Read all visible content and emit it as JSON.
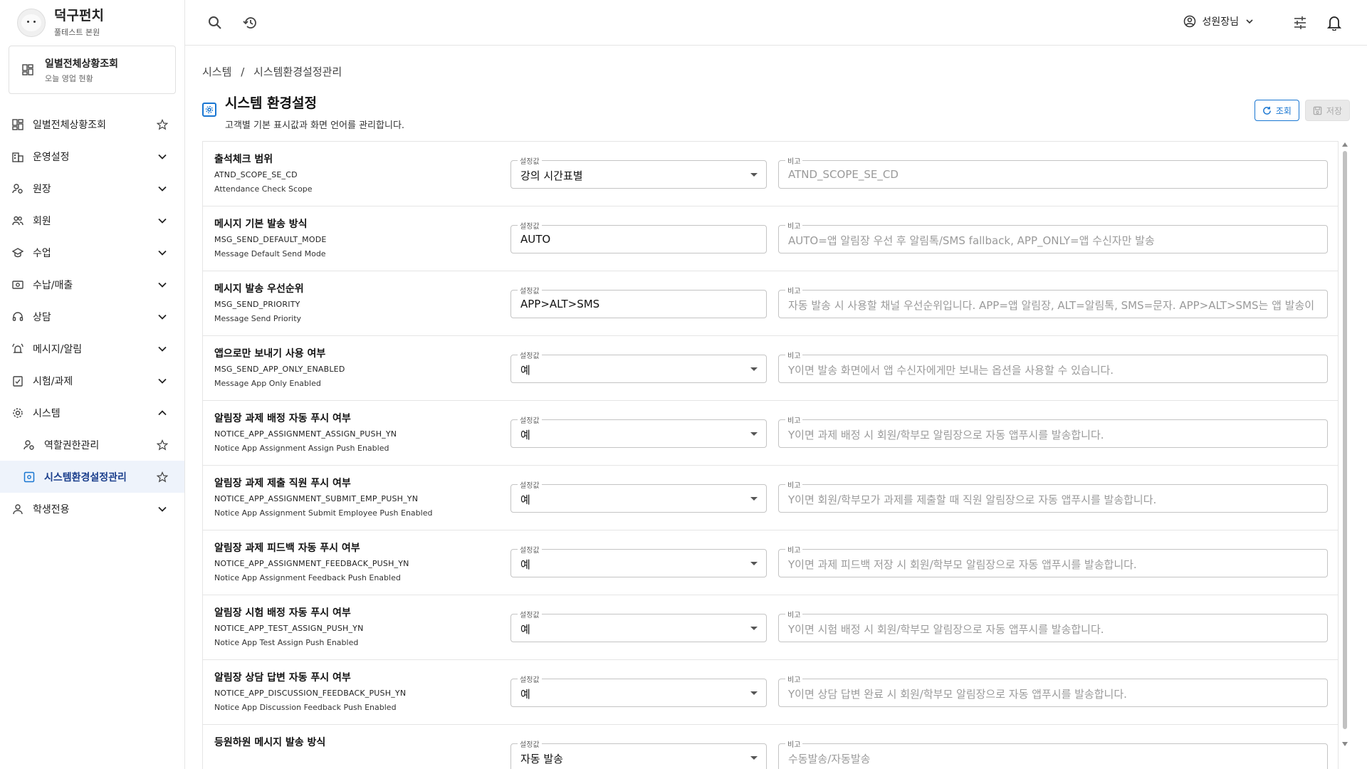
{
  "brand": {
    "title": "덕구펀치",
    "subtitle": "풀테스트 본원"
  },
  "quick": {
    "title": "일별전체상황조회",
    "subtitle": "오늘 영업 현황"
  },
  "nav": {
    "items": [
      {
        "label": "일별전체상황조회",
        "icon": "dashboard-icon",
        "trail": "star-icon"
      },
      {
        "label": "운영설정",
        "icon": "building-icon",
        "trail": "chevron-down-icon"
      },
      {
        "label": "원장",
        "icon": "person-settings-icon",
        "trail": "chevron-down-icon"
      },
      {
        "label": "회원",
        "icon": "people-icon",
        "trail": "chevron-down-icon"
      },
      {
        "label": "수업",
        "icon": "school-icon",
        "trail": "chevron-down-icon"
      },
      {
        "label": "수납/매출",
        "icon": "money-icon",
        "trail": "chevron-down-icon"
      },
      {
        "label": "상담",
        "icon": "headset-icon",
        "trail": "chevron-down-icon"
      },
      {
        "label": "메시지/알림",
        "icon": "bell-ring-icon",
        "trail": "chevron-down-icon"
      },
      {
        "label": "시험/과제",
        "icon": "checklist-icon",
        "trail": "chevron-down-icon"
      },
      {
        "label": "시스템",
        "icon": "gear-icon",
        "trail": "chevron-up-icon"
      },
      {
        "label": "역할권한관리",
        "icon": "person-settings-icon",
        "trail": "star-icon"
      },
      {
        "label": "시스템환경설정관리",
        "icon": "settings-box-icon",
        "trail": "star-icon"
      },
      {
        "label": "학생전용",
        "icon": "person-icon",
        "trail": "chevron-down-icon"
      }
    ]
  },
  "header": {
    "user_name": "성원장님"
  },
  "breadcrumb": {
    "root": "시스템",
    "sep": "/",
    "current": "시스템환경설정관리"
  },
  "page": {
    "title": "시스템 환경설정",
    "description": "고객별 기본 표시값과 화면 언어를 관리합니다."
  },
  "actions": {
    "search_label": "조회",
    "save_label": "저장"
  },
  "field_labels": {
    "value": "설정값",
    "note": "비고"
  },
  "settings": [
    {
      "name": "출석체크 범위",
      "code": "ATND_SCOPE_SE_CD",
      "en": "Attendance Check Scope",
      "value": "강의 시간표별",
      "select": true,
      "note": "ATND_SCOPE_SE_CD"
    },
    {
      "name": "메시지 기본 발송 방식",
      "code": "MSG_SEND_DEFAULT_MODE",
      "en": "Message Default Send Mode",
      "value": "AUTO",
      "select": false,
      "note": "AUTO=앱 알림장 우선 후 알림톡/SMS fallback, APP_ONLY=앱 수신자만 발송"
    },
    {
      "name": "메시지 발송 우선순위",
      "code": "MSG_SEND_PRIORITY",
      "en": "Message Send Priority",
      "value": "APP>ALT>SMS",
      "select": false,
      "note": "자동 발송 시 사용할 채널 우선순위입니다. APP=앱 알림장, ALT=알림톡, SMS=문자. APP>ALT>SMS는 앱 발송이"
    },
    {
      "name": "앱으로만 보내기 사용 여부",
      "code": "MSG_SEND_APP_ONLY_ENABLED",
      "en": "Message App Only Enabled",
      "value": "예",
      "select": true,
      "note": "Y이면 발송 화면에서 앱 수신자에게만 보내는 옵션을 사용할 수 있습니다."
    },
    {
      "name": "알림장 과제 배정 자동 푸시 여부",
      "code": "NOTICE_APP_ASSIGNMENT_ASSIGN_PUSH_YN",
      "en": "Notice App Assignment Assign Push Enabled",
      "value": "예",
      "select": true,
      "note": "Y이면 과제 배정 시 회원/학부모 알림장으로 자동 앱푸시를 발송합니다."
    },
    {
      "name": "알림장 과제 제출 직원 푸시 여부",
      "code": "NOTICE_APP_ASSIGNMENT_SUBMIT_EMP_PUSH_YN",
      "en": "Notice App Assignment Submit Employee Push Enabled",
      "value": "예",
      "select": true,
      "note": "Y이면 회원/학부모가 과제를 제출할 때 직원 알림장으로 자동 앱푸시를 발송합니다."
    },
    {
      "name": "알림장 과제 피드백 자동 푸시 여부",
      "code": "NOTICE_APP_ASSIGNMENT_FEEDBACK_PUSH_YN",
      "en": "Notice App Assignment Feedback Push Enabled",
      "value": "예",
      "select": true,
      "note": "Y이면 과제 피드백 저장 시 회원/학부모 알림장으로 자동 앱푸시를 발송합니다."
    },
    {
      "name": "알림장 시험 배정 자동 푸시 여부",
      "code": "NOTICE_APP_TEST_ASSIGN_PUSH_YN",
      "en": "Notice App Test Assign Push Enabled",
      "value": "예",
      "select": true,
      "note": "Y이면 시험 배정 시 회원/학부모 알림장으로 자동 앱푸시를 발송합니다."
    },
    {
      "name": "알림장 상담 답변 자동 푸시 여부",
      "code": "NOTICE_APP_DISCUSSION_FEEDBACK_PUSH_YN",
      "en": "Notice App Discussion Feedback Push Enabled",
      "value": "예",
      "select": true,
      "note": "Y이면 상담 답변 완료 시 회원/학부모 알림장으로 자동 앱푸시를 발송합니다."
    },
    {
      "name": "등원하원 메시지 발송 방식",
      "code": "",
      "en": "",
      "value": "자동 발송",
      "select": true,
      "note": "수동발송/자동발송"
    }
  ],
  "colors": {
    "accent": "#1976d2",
    "active_bg": "#eef3fb",
    "active_text": "#1a3e8c"
  }
}
